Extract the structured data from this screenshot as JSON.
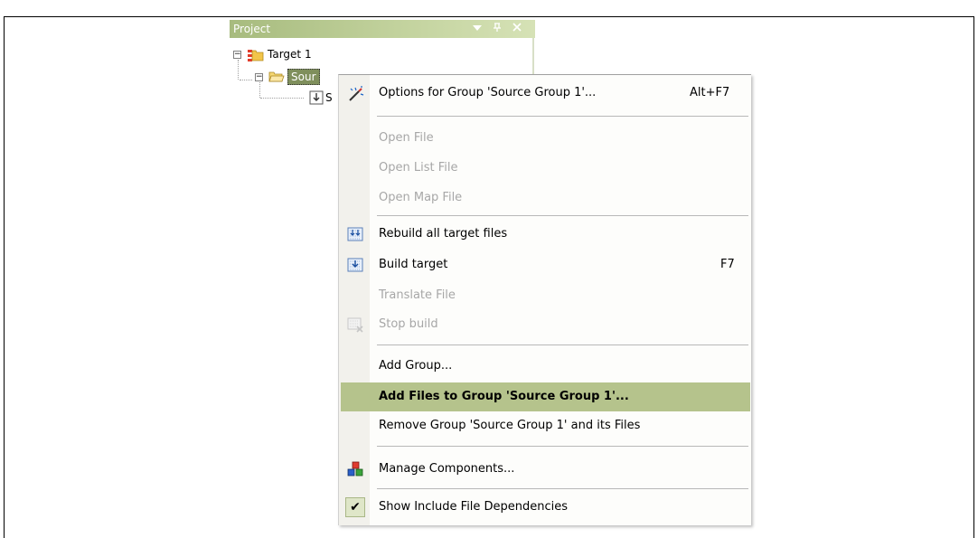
{
  "project_panel": {
    "title": "Project",
    "titlebar_icons": [
      "dropdown-icon",
      "pin-icon",
      "close-icon"
    ],
    "tree": [
      {
        "label": "Target 1",
        "expander": "−"
      },
      {
        "label": "Sour",
        "expander": "−"
      },
      {
        "label": "S"
      }
    ]
  },
  "context_menu": {
    "items": [
      {
        "label": "Options for Group 'Source Group 1'...",
        "shortcut": "Alt+F7",
        "enabled": true,
        "icon": "options-wand-icon"
      },
      {
        "separator": true
      },
      {
        "label": "Open File",
        "enabled": false
      },
      {
        "label": "Open List File",
        "enabled": false
      },
      {
        "label": "Open Map File",
        "enabled": false
      },
      {
        "separator": true
      },
      {
        "label": "Rebuild all target files",
        "enabled": true,
        "icon": "rebuild-icon"
      },
      {
        "label": "Build target",
        "shortcut": "F7",
        "enabled": true,
        "icon": "build-icon"
      },
      {
        "label": "Translate File",
        "enabled": false
      },
      {
        "label": "Stop build",
        "enabled": false,
        "icon": "stop-build-icon"
      },
      {
        "separator": true
      },
      {
        "label": "Add Group...",
        "enabled": true
      },
      {
        "label": "Add Files to Group 'Source Group 1'...",
        "enabled": true,
        "highlighted": true
      },
      {
        "label": "Remove Group 'Source Group 1' and its Files",
        "enabled": true
      },
      {
        "separator": true
      },
      {
        "label": "Manage Components...",
        "enabled": true,
        "icon": "components-icon"
      },
      {
        "separator": true
      },
      {
        "label": "Show Include File Dependencies",
        "enabled": true,
        "checked": true
      }
    ],
    "highlight_color": "#b5c38c"
  }
}
